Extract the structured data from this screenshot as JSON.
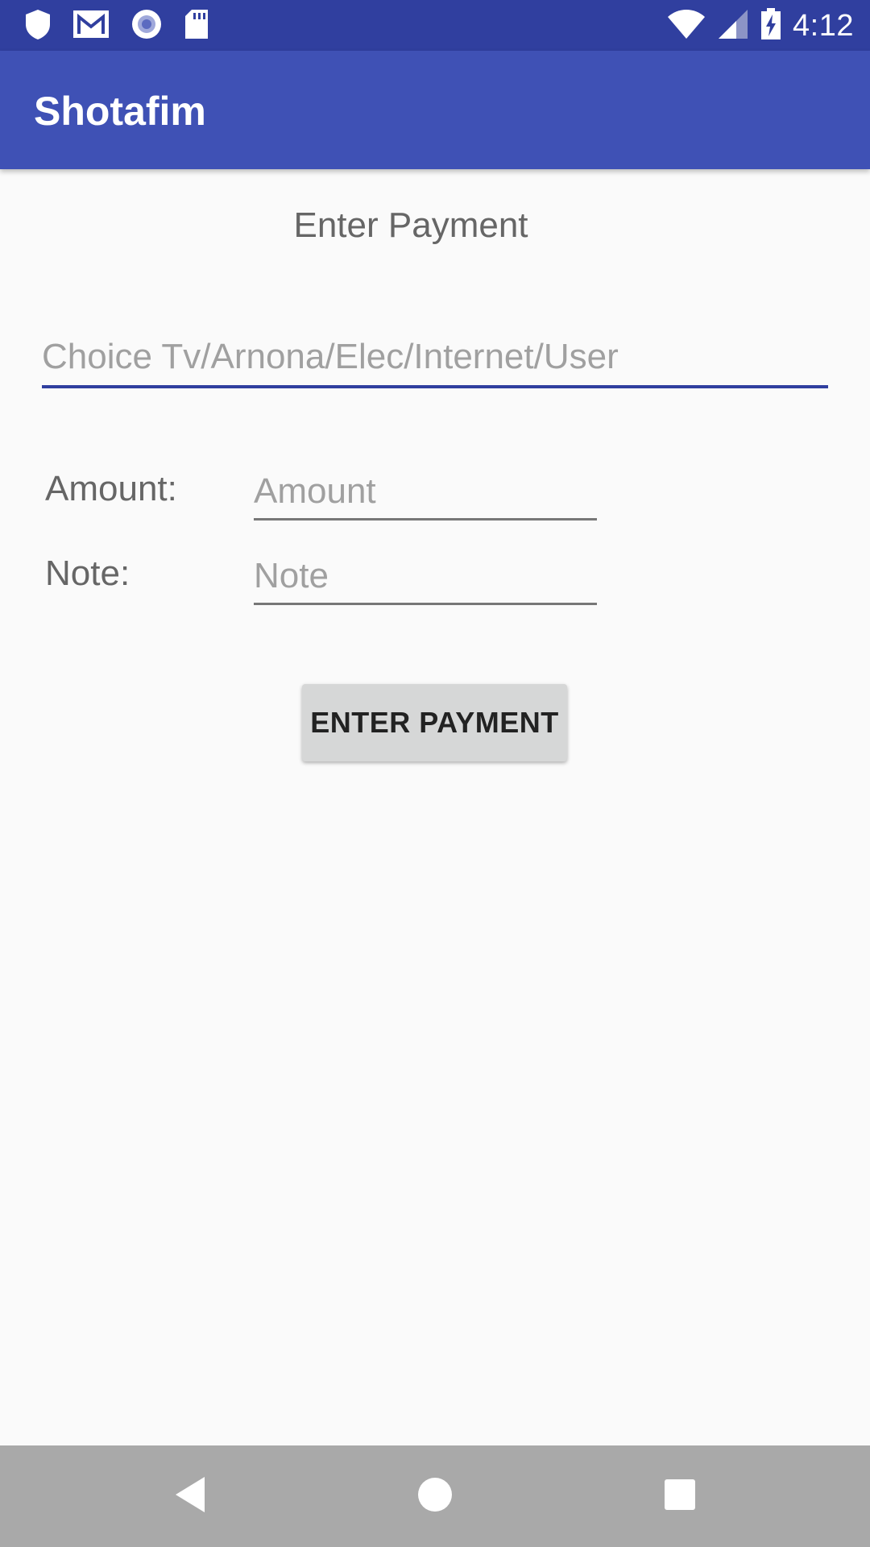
{
  "status_bar": {
    "time": "4:12",
    "icons_left": [
      "shield-icon",
      "gmail-icon",
      "radio-circle-icon",
      "sd-card-icon"
    ],
    "icons_right": [
      "wifi-icon",
      "cell-signal-icon",
      "battery-charging-icon"
    ]
  },
  "app_bar": {
    "title": "Shotafim",
    "background": "#3f51b5",
    "status_background": "#303f9f"
  },
  "form": {
    "heading": "Enter Payment",
    "choice_placeholder": "Choice Tv/Arnona/Elec/Internet/User",
    "choice_value": "",
    "amount_label": "Amount:",
    "amount_placeholder": "Amount",
    "amount_value": "",
    "note_label": "Note:",
    "note_placeholder": "Note",
    "note_value": "",
    "submit_label": "ENTER PAYMENT"
  },
  "nav_bar": {
    "buttons": [
      "back-icon",
      "home-icon",
      "recents-icon"
    ],
    "background": "#a9a9a9"
  }
}
